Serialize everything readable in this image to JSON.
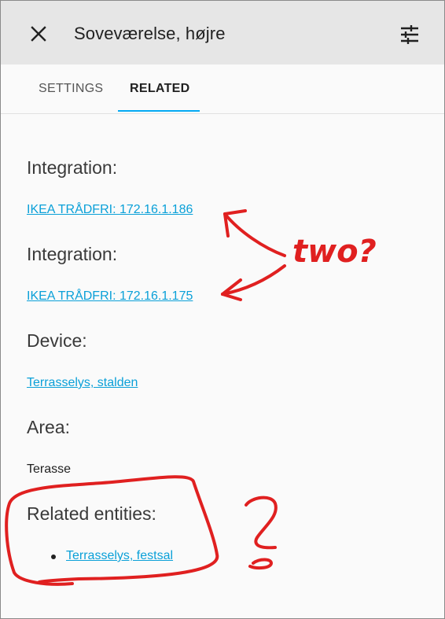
{
  "dialog": {
    "title": "Soveværelse, højre",
    "close_icon": "close-icon",
    "settings_icon": "tune-icon"
  },
  "tabs": [
    {
      "label": "SETTINGS",
      "active": false
    },
    {
      "label": "RELATED",
      "active": true
    }
  ],
  "related": {
    "integration_1": {
      "heading": "Integration:",
      "link": "IKEA TRÅDFRI: 172.16.1.186"
    },
    "integration_2": {
      "heading": "Integration:",
      "link": "IKEA TRÅDFRI: 172.16.1.175"
    },
    "device": {
      "heading": "Device:",
      "link": "Terrasselys, stalden"
    },
    "area": {
      "heading": "Area:",
      "value": "Terasse"
    },
    "entities": {
      "heading": "Related entities:",
      "items": [
        "Terrasselys, festsal"
      ]
    }
  },
  "annotations": {
    "two_text": "two?",
    "question_mark": "?",
    "color": "#e02020"
  },
  "colors": {
    "accent": "#03a9f4",
    "link": "#0aa0d8",
    "header_bg": "#e6e6e6"
  }
}
